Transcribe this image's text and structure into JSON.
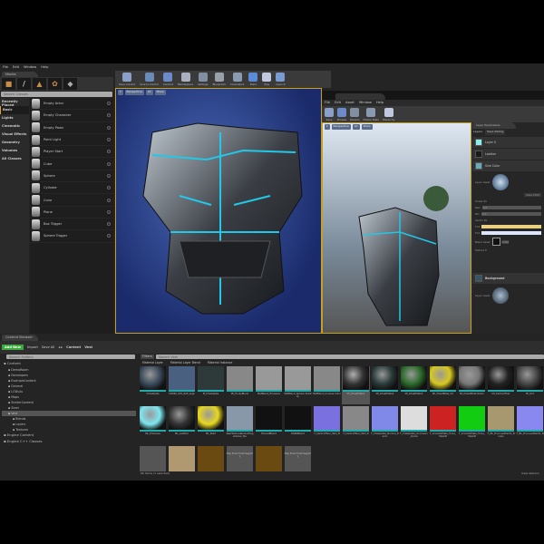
{
  "menu": [
    "File",
    "Edit",
    "Window",
    "Help"
  ],
  "modes_tab": "Modes",
  "search_classes": "Search Classes",
  "categories": [
    "Recently Placed",
    "Basic",
    "Lights",
    "Cinematic",
    "Visual Effects",
    "Geometry",
    "Volumes",
    "All Classes"
  ],
  "selected_category": "Basic",
  "places": [
    "Empty Actor",
    "Empty Character",
    "Empty Pawn",
    "Point Light",
    "Player Start",
    "Cube",
    "Sphere",
    "Cylinder",
    "Cone",
    "Plane",
    "Box Trigger",
    "Sphere Trigger"
  ],
  "toolbar": [
    "Save Current",
    "Source Control",
    "Content",
    "Marketplace",
    "Settings",
    "Blueprints",
    "Cinematics",
    "Build",
    "Play",
    "Launch"
  ],
  "viewport": {
    "perspective": "Perspective",
    "lit": "Lit",
    "show": "Show"
  },
  "editor": {
    "menu": [
      "File",
      "Edit",
      "Asset",
      "Window",
      "Help"
    ],
    "toolbar": [
      "Save",
      "Browse",
      "Params",
      "Mobile Stats",
      "Hierarchy"
    ]
  },
  "layers_panel": {
    "tab": "Layer Parameters",
    "header": "Layers",
    "save_sibling": "Save Sibling",
    "save_child": "Save Child",
    "layers": [
      "Layer 0",
      "Leather",
      "Sine Color",
      "Background"
    ],
    "labels": {
      "layer_asset": "Layer Asset",
      "scalar": "Scalar Pa",
      "vector": "Vector Pa",
      "blend_asset": "Blend Asset",
      "texture": "Texture P",
      "tint": "Tint",
      "max": "Max",
      "min": "Min",
      "val1": "0.0",
      "val2": "0.0",
      "blend_name": "RGBA"
    }
  },
  "content_browser": {
    "tab": "Content Browser",
    "add_new": "Add New",
    "import": "Import",
    "save_all": "Save All",
    "path": [
      "Content",
      "Vest"
    ],
    "search_folders": "Search Folders",
    "filters": "Filters",
    "search_assets": "Search Vest",
    "type_tabs": [
      "Material Layer",
      "Material Layer Blend",
      "Material Instance"
    ],
    "tree": [
      "Content",
      "DemoRoom",
      "Developers",
      "ExampleContent",
      "General",
      "LODs4u",
      "Maps",
      "StarterContent",
      "Steel",
      "Vest",
      "Blends",
      "Layers",
      "Textures",
      "Engine Content",
      "Engine C++ Classes"
    ],
    "status": "66 items (1 selected)",
    "view_options": "View Options",
    "assets": [
      [
        "Chestplate",
        "#3a4a5a"
      ],
      [
        "DS560_025_Refl_ergb",
        "#4a6080"
      ],
      [
        "M_Chestplate",
        "#2e3a3a"
      ],
      [
        "MI_FunkyBlend",
        "#888"
      ],
      [
        "MatBlend_Emissive",
        "#999"
      ],
      [
        "MatBlend_Sphere Position",
        "#999"
      ],
      [
        "MatBlend_Inverse Color",
        "#888"
      ],
      [
        "MI_ChestPlate1",
        "#333"
      ],
      [
        "MI_ChestPlate2",
        "#2a3a3a"
      ],
      [
        "MI_ChestPlate3",
        "#2a6a2a"
      ],
      [
        "MI_ChestPlate_V2",
        "#d8c820"
      ],
      [
        "MI_ChestPlate Demo",
        "#777"
      ],
      [
        "MI_CarbonFiber",
        "#222"
      ],
      [
        "MI_Dirt",
        "#444"
      ],
      [
        "ML_Emissive",
        "#7ee6f0"
      ],
      [
        "ML_Leather",
        "#333"
      ],
      [
        "ML_Paint",
        "#e8d820"
      ],
      [
        "NewTextureRenderTargetCube_Tex",
        "#8898a8"
      ],
      [
        "FannedBlend",
        "#111"
      ],
      [
        "RGBABlend",
        "#111"
      ],
      [
        "T_CarbonFiber_Twill_N",
        "#7a70e0"
      ],
      [
        "T_CarbonFiber_Twill_R",
        "#888"
      ],
      [
        "T_Chestplate_Normal_Demo",
        "#8088e8"
      ],
      [
        "T_Chestplate_Occlusion_Demo",
        "#ddd"
      ],
      [
        "T_GroutedPlate_Tonia_MaskB",
        "#c22"
      ],
      [
        "T_GroutedPlate_Tonia_MaskB",
        "#1c1"
      ],
      [
        "T_ML_Fine Leather01_Brown",
        "#a89870"
      ],
      [
        "T_ML_Fine Leather01_N",
        "#8888f0"
      ],
      [
        "",
        "#555"
      ],
      [
        "",
        "#b09870"
      ],
      [
        "",
        "#6a4a10"
      ],
      [
        "Map Build Data Registry",
        "#555"
      ],
      [
        "",
        "#6a4a10"
      ],
      [
        "Map Build Data Registry",
        "#555"
      ]
    ]
  },
  "colors": {
    "accent": "#e0a030",
    "cyan": "#22c8e8",
    "add_new": "#3aa83a"
  }
}
